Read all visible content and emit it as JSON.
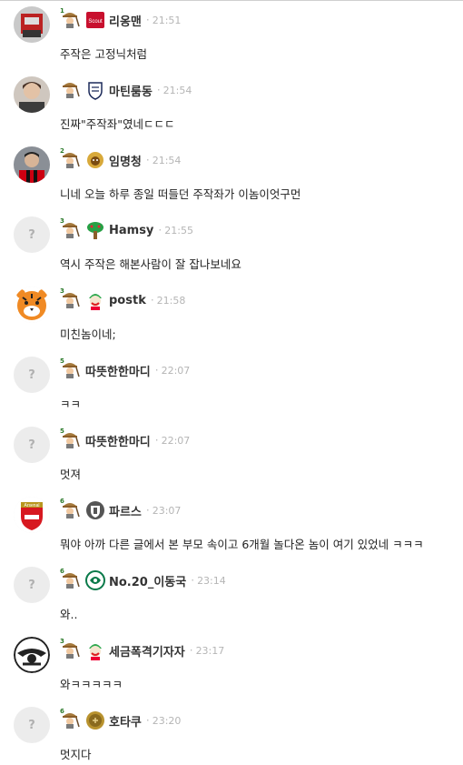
{
  "comments": [
    {
      "nickname": "리옹맨",
      "time": "21:51",
      "text": "주작은 고정닉처럼",
      "level": "1",
      "avatar": "photo-red",
      "emblem": "scout-badge-icon"
    },
    {
      "nickname": "마틴룸동",
      "time": "21:54",
      "text": "진짜\"주작좌\"였네ㄷㄷㄷ",
      "level": "",
      "avatar": "photo-person",
      "emblem": "crest-icon"
    },
    {
      "nickname": "임명청",
      "time": "21:54",
      "text": "니네 오늘 하루 종일 떠들던 주작좌가 이놈이엇구먼",
      "level": "2",
      "avatar": "photo-player",
      "emblem": "lion-emblem-icon"
    },
    {
      "nickname": "Hamsy",
      "time": "21:55",
      "text": "역시 주작은 해본사람이 잘 잡나보네요",
      "level": "3",
      "avatar": "default",
      "emblem": "tree-icon"
    },
    {
      "nickname": "postk",
      "time": "21:58",
      "text": "미친놈이네;",
      "level": "3",
      "avatar": "tiger",
      "emblem": "joker-icon"
    },
    {
      "nickname": "따뜻한한마디",
      "time": "22:07",
      "text": "ㅋㅋ",
      "level": "5",
      "avatar": "default",
      "emblem": ""
    },
    {
      "nickname": "따뜻한한마디",
      "time": "22:07",
      "text": "멋져",
      "level": "5",
      "avatar": "default",
      "emblem": ""
    },
    {
      "nickname": "파르스",
      "time": "23:07",
      "text": "뭐야 아까 다른 글에서 본 부모 속이고 6개월 놀다온 놈이 여기 있었네 ㅋㅋㅋ",
      "level": "6",
      "avatar": "arsenal",
      "emblem": "club-crest-icon"
    },
    {
      "nickname": "No.20_이동국",
      "time": "23:14",
      "text": "와..",
      "level": "6",
      "avatar": "default",
      "emblem": "green-emblem-icon"
    },
    {
      "nickname": "세금폭격기자자",
      "time": "23:17",
      "text": "와ㅋㅋㅋㅋㅋ",
      "level": "3",
      "avatar": "eagle",
      "emblem": "joker-icon"
    },
    {
      "nickname": "호타쿠",
      "time": "23:20",
      "text": "멋지다",
      "level": "6",
      "avatar": "default",
      "emblem": "gold-coin-icon"
    }
  ],
  "colors": {
    "nickname": "#333333",
    "time": "#b5b5b5",
    "text": "#222222",
    "avatar_bg": "#ececec"
  }
}
